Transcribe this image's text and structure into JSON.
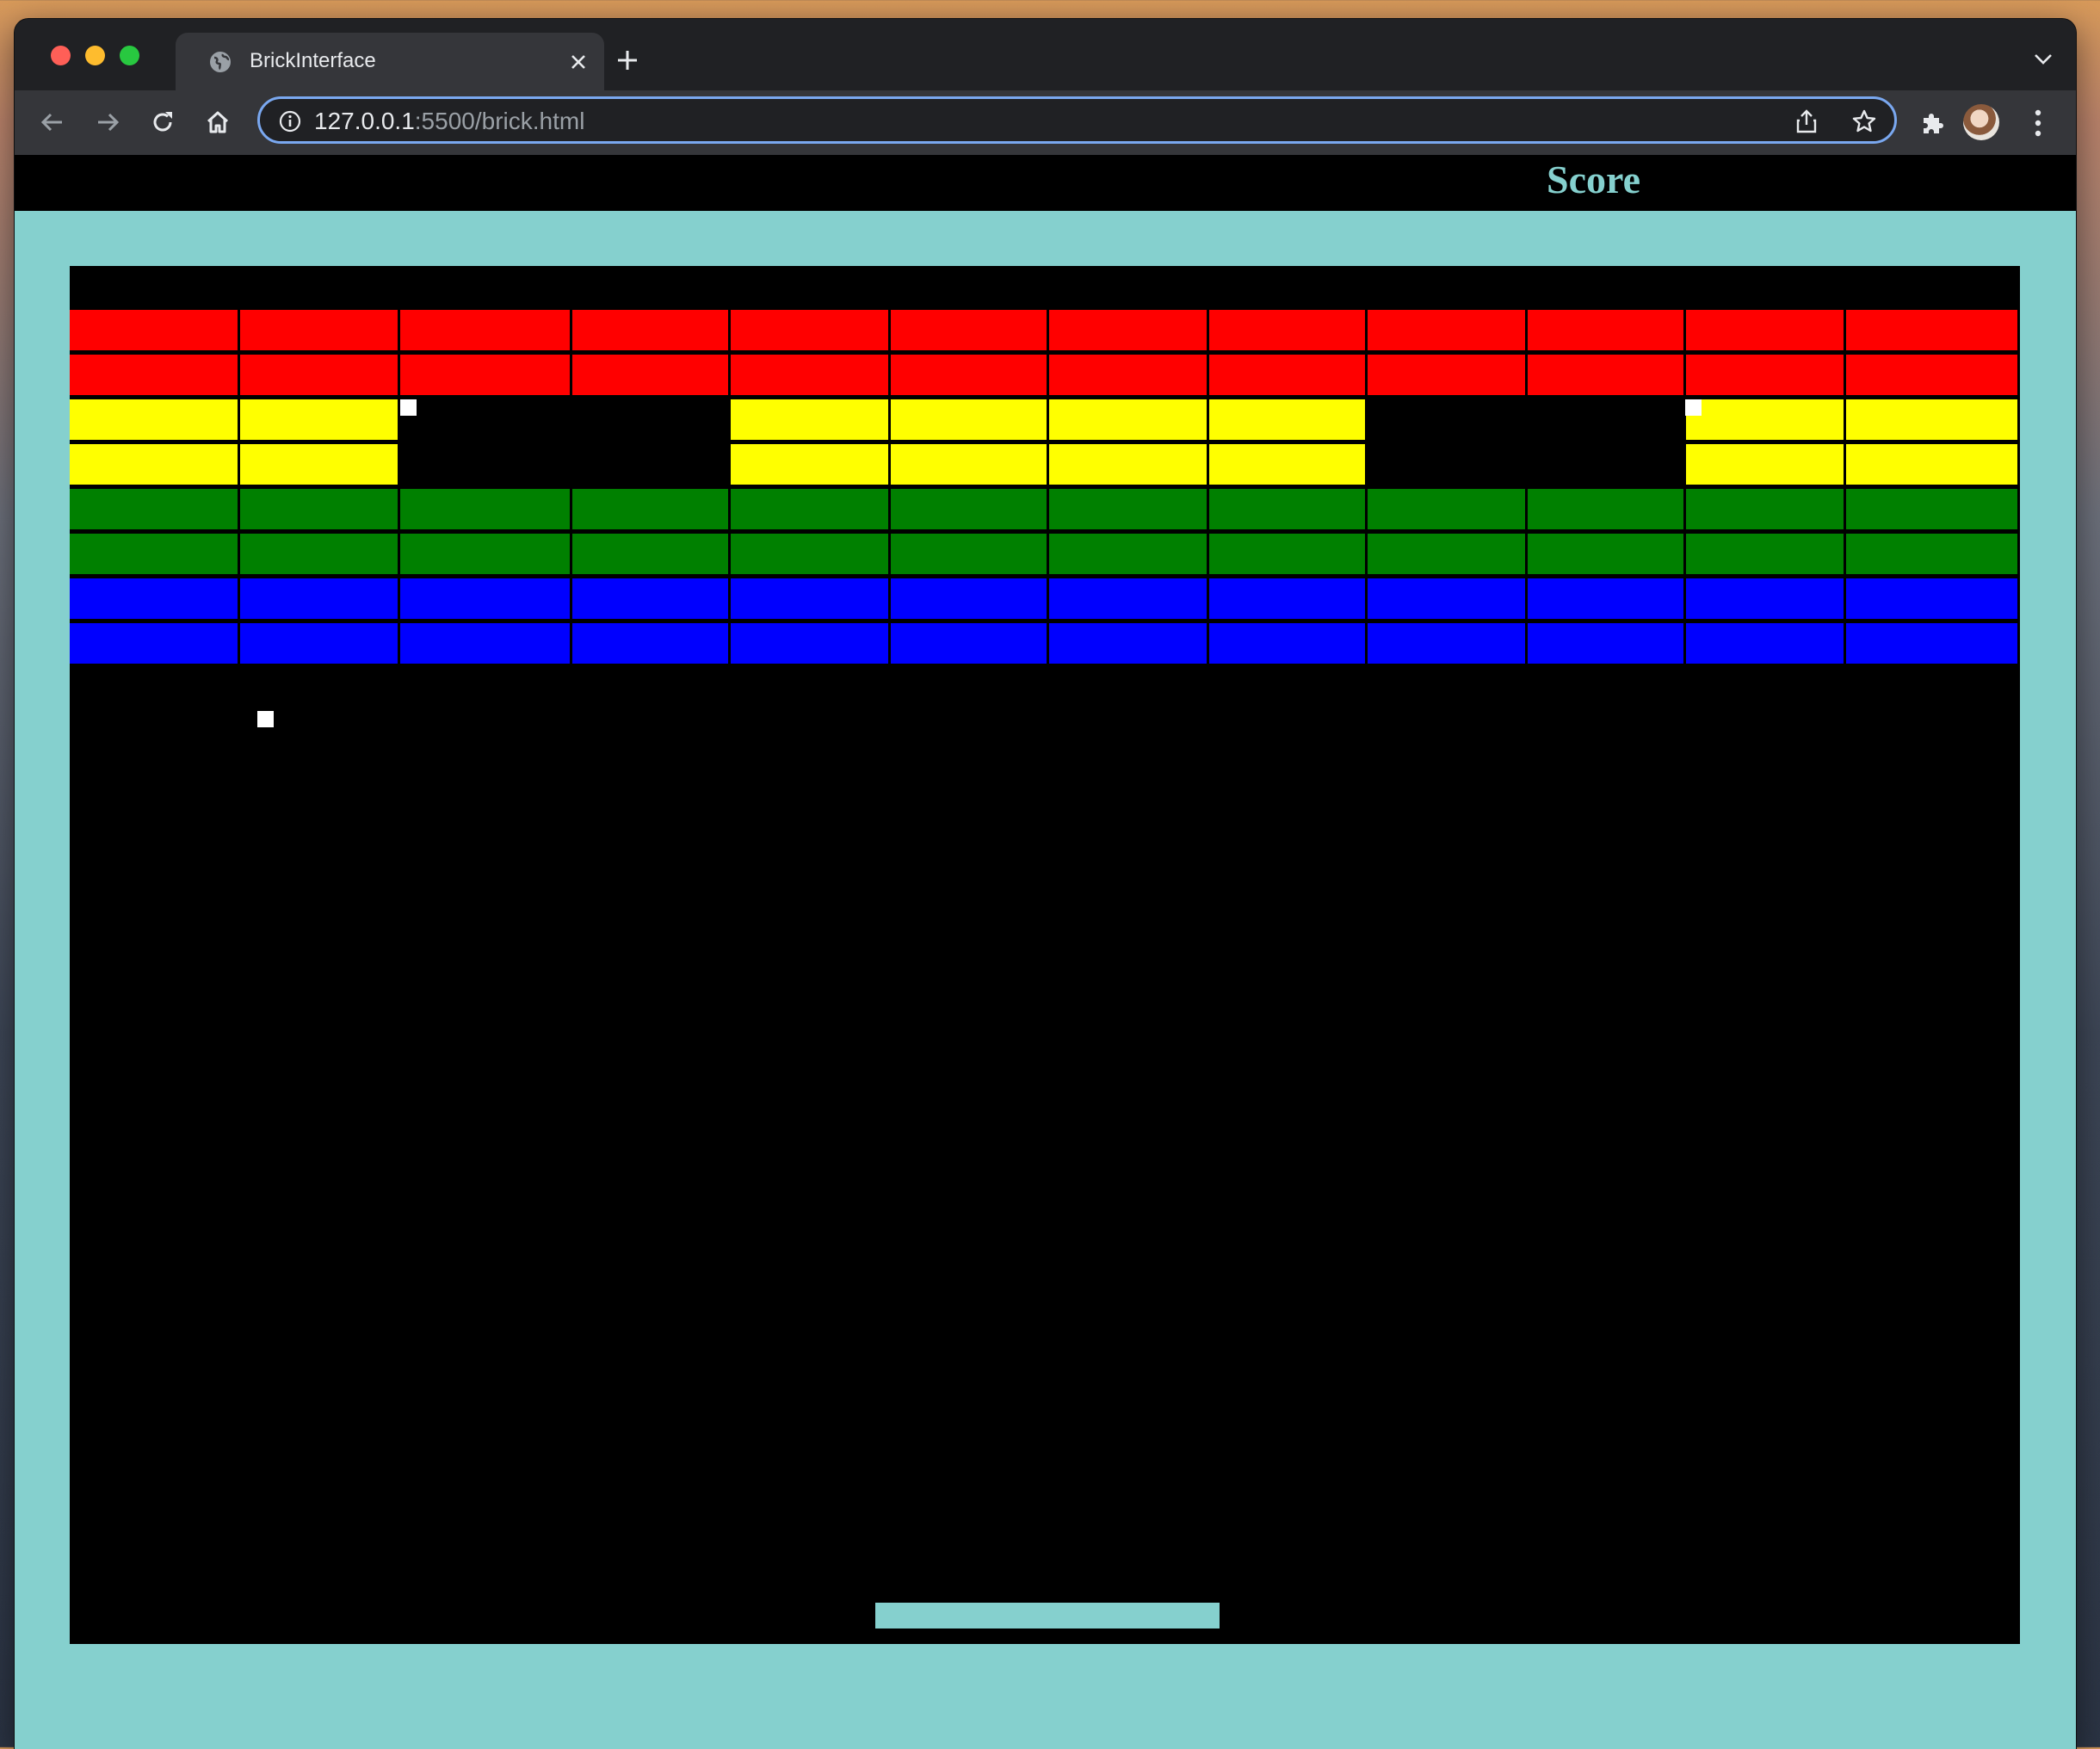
{
  "browser": {
    "tab_title": "BrickInterface",
    "url_host": "127.0.0.1",
    "url_path": ":5500/brick.html"
  },
  "game": {
    "score_label": "Score",
    "colors": {
      "red": "#ff0000",
      "yellow": "#ffff00",
      "green": "#008000",
      "blue": "#0000ff",
      "board": "#000000",
      "paddle": "#85d0ce",
      "ball": "#ffffff",
      "page_background": "#85d0ce"
    },
    "brick_rows": [
      {
        "color": "red",
        "present": [
          1,
          1,
          1,
          1,
          1,
          1,
          1,
          1,
          1,
          1,
          1,
          1
        ]
      },
      {
        "color": "red",
        "present": [
          1,
          1,
          1,
          1,
          1,
          1,
          1,
          1,
          1,
          1,
          1,
          1
        ]
      },
      {
        "color": "yellow",
        "present": [
          1,
          1,
          0,
          0,
          1,
          1,
          1,
          1,
          0,
          0,
          1,
          1
        ]
      },
      {
        "color": "yellow",
        "present": [
          1,
          1,
          0,
          0,
          1,
          1,
          1,
          1,
          0,
          0,
          1,
          1
        ]
      },
      {
        "color": "green",
        "present": [
          1,
          1,
          1,
          1,
          1,
          1,
          1,
          1,
          1,
          1,
          1,
          1
        ]
      },
      {
        "color": "green",
        "present": [
          1,
          1,
          1,
          1,
          1,
          1,
          1,
          1,
          1,
          1,
          1,
          1
        ]
      },
      {
        "color": "blue",
        "present": [
          1,
          1,
          1,
          1,
          1,
          1,
          1,
          1,
          1,
          1,
          1,
          1
        ]
      },
      {
        "color": "blue",
        "present": [
          1,
          1,
          1,
          1,
          1,
          1,
          1,
          1,
          1,
          1,
          1,
          1
        ]
      }
    ],
    "ball_count": 3
  }
}
